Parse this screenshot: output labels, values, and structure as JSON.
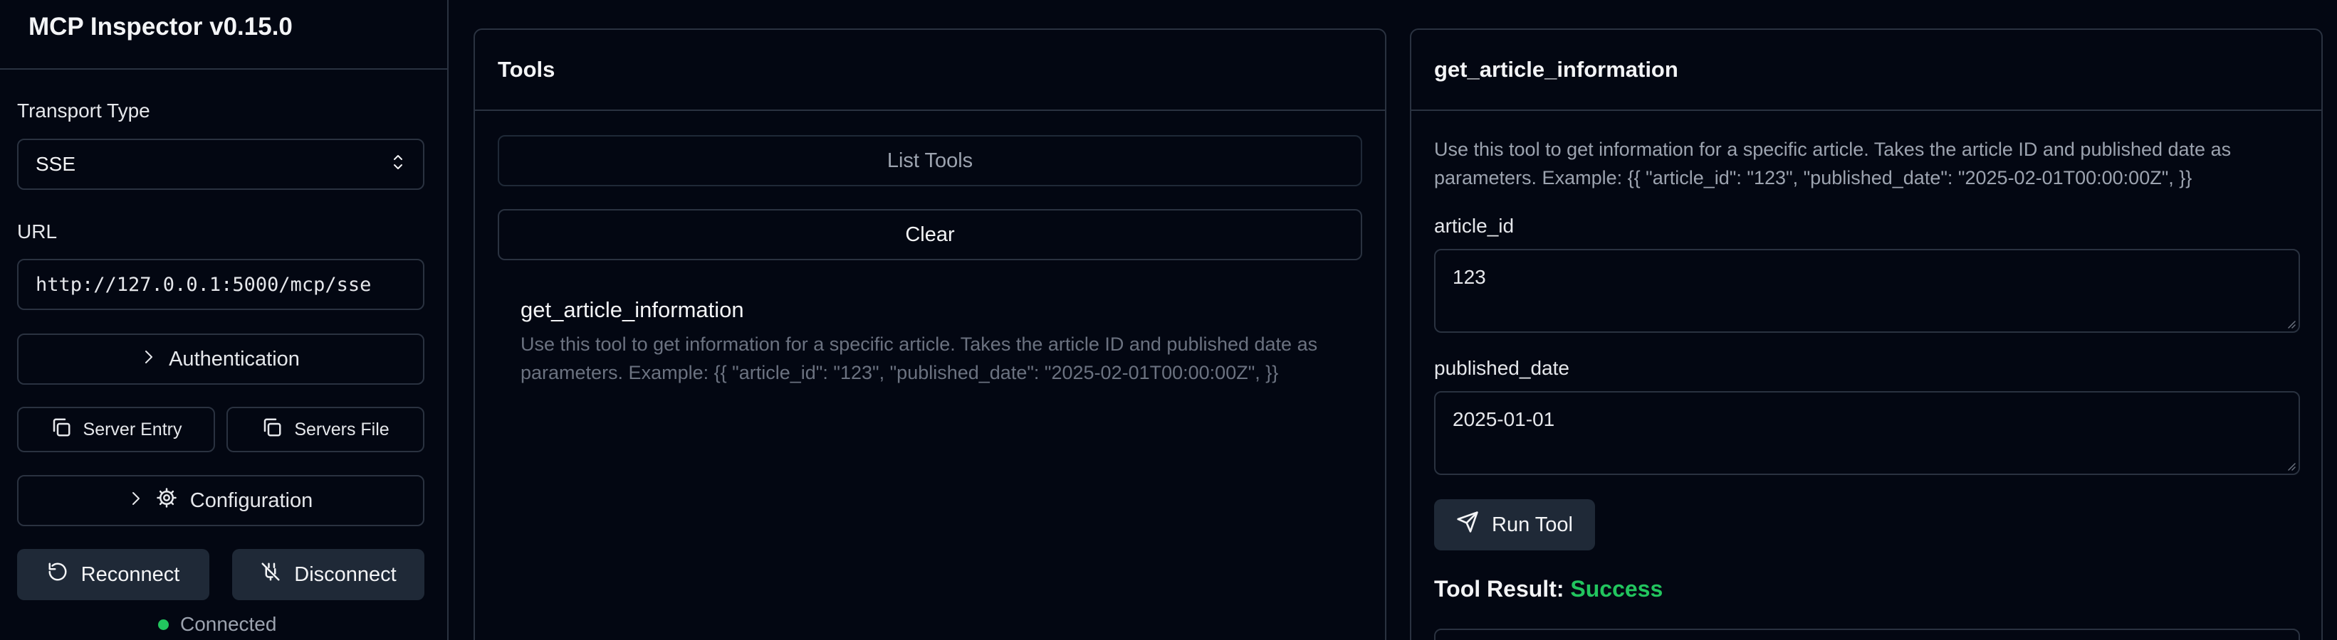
{
  "app": {
    "title": "MCP Inspector v0.15.0"
  },
  "sidebar": {
    "transport_label": "Transport Type",
    "transport_value": "SSE",
    "url_label": "URL",
    "url_value": "http://127.0.0.1:5000/mcp/sse",
    "authentication_label": "Authentication",
    "server_entry_label": "Server Entry",
    "servers_file_label": "Servers File",
    "configuration_label": "Configuration",
    "reconnect_label": "Reconnect",
    "disconnect_label": "Disconnect",
    "status_text": "Connected",
    "status_color": "#22c55e"
  },
  "tools_panel": {
    "title": "Tools",
    "list_tools_label": "List Tools",
    "clear_label": "Clear",
    "items": [
      {
        "name": "get_article_information",
        "description": "Use this tool to get information for a specific article. Takes the article ID and published date as parameters. Example: {{ \"article_id\": \"123\", \"published_date\": \"2025-02-01T00:00:00Z\", }}"
      }
    ]
  },
  "tool_detail": {
    "title": "get_article_information",
    "description": "Use this tool to get information for a specific article. Takes the article ID and published date as parameters. Example: {{ \"article_id\": \"123\", \"published_date\": \"2025-02-01T00:00:00Z\", }}",
    "fields": [
      {
        "label": "article_id",
        "value": "123"
      },
      {
        "label": "published_date",
        "value": "2025-01-01"
      }
    ],
    "run_label": "Run Tool",
    "result_label": "Tool Result:",
    "result_status": "Success",
    "result_color": "#22c55e"
  }
}
